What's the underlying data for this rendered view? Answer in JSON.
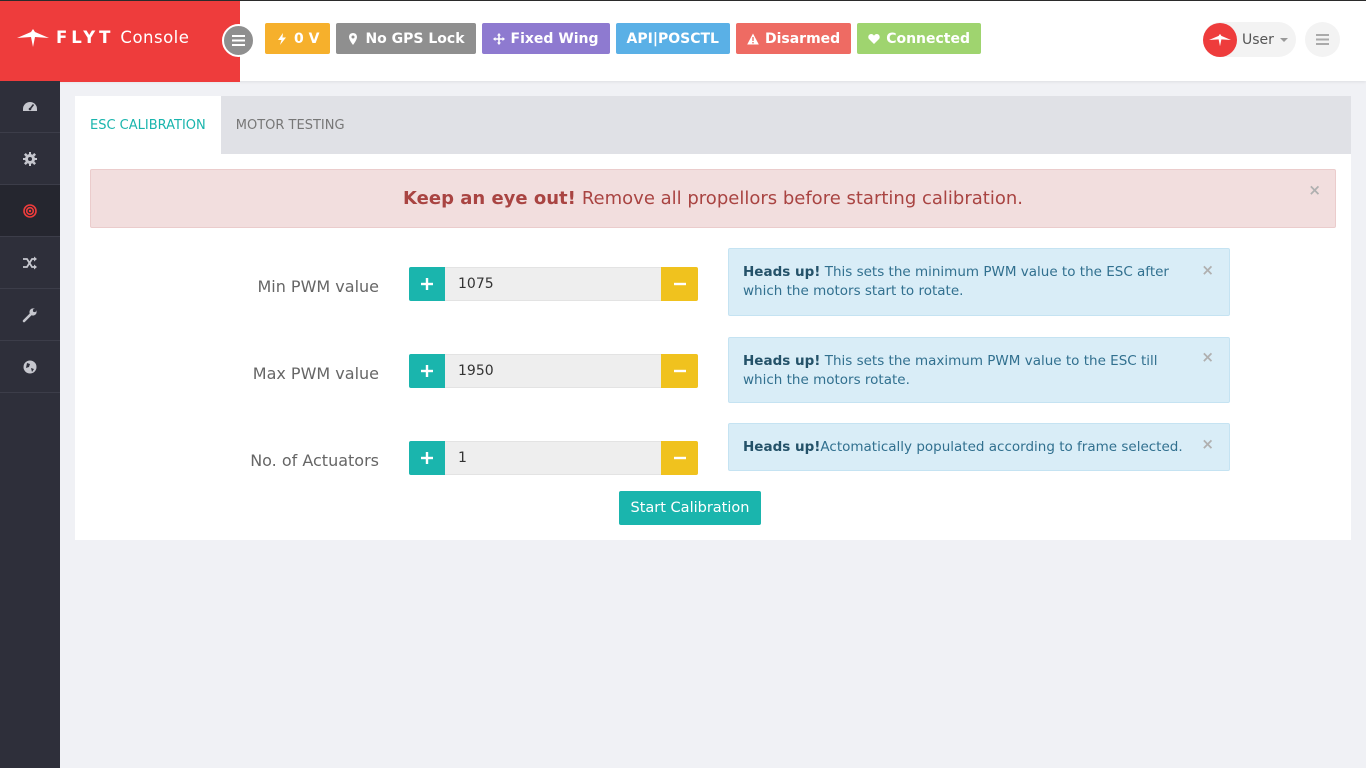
{
  "brand": {
    "name_bold": "FLYT",
    "name": "Console"
  },
  "status_badges": [
    {
      "icon": "bolt-icon",
      "label": "0 V",
      "color": "#f6b02c"
    },
    {
      "icon": "map-marker-icon",
      "label": "No GPS Lock",
      "color": "#8f8f8f"
    },
    {
      "icon": "arrows-move-icon",
      "label": "Fixed Wing",
      "color": "#8e7ad0"
    },
    {
      "icon": "",
      "label": "API|POSCTL",
      "color": "#5ab0e6"
    },
    {
      "icon": "warning-icon",
      "label": "Disarmed",
      "color": "#ee6b63"
    },
    {
      "icon": "heart-icon",
      "label": "Connected",
      "color": "#9fd46f"
    }
  ],
  "user": {
    "name": "User"
  },
  "sidebar": {
    "items": [
      {
        "icon": "dashboard-icon",
        "active": false
      },
      {
        "icon": "gear-icon",
        "active": false
      },
      {
        "icon": "target-icon",
        "active": true
      },
      {
        "icon": "shuffle-icon",
        "active": false
      },
      {
        "icon": "wrench-icon",
        "active": false
      },
      {
        "icon": "globe-icon",
        "active": false
      }
    ]
  },
  "tabs": [
    {
      "label": "ESC CALIBRATION",
      "active": true
    },
    {
      "label": "MOTOR TESTING",
      "active": false
    }
  ],
  "warning": {
    "strong": "Keep an eye out!",
    "text": "Remove all propellors before starting calibration."
  },
  "fields": [
    {
      "label": "Min PWM value",
      "value": "1075",
      "info_strong": "Heads up!",
      "info_text": " This sets the minimum PWM value to the ESC after which the motors start to rotate."
    },
    {
      "label": "Max PWM value",
      "value": "1950",
      "info_strong": "Heads up!",
      "info_text": " This sets the maximum PWM value to the ESC till which the motors rotate."
    },
    {
      "label": "No. of Actuators",
      "value": "1",
      "info_strong": "Heads up!",
      "info_text": "Actomatically populated according to frame selected."
    }
  ],
  "start_button": {
    "label": "Start Calibration"
  },
  "colors": {
    "brand_red": "#ee3c3c",
    "teal": "#1ab5ad",
    "yellow": "#f0c21e",
    "sidebar": "#2e2f3a"
  }
}
